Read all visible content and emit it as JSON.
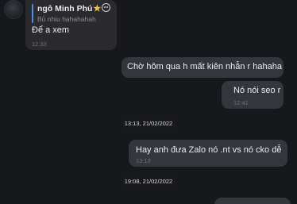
{
  "messages": [
    {
      "sender": "ngô Minh Phú",
      "quote": "Bủ nhiu hahahahah",
      "text": "Để a xem",
      "time": "12:33"
    },
    {
      "text": "Chờ hôm qua h mất kiên nhẫn r hahaha"
    },
    {
      "text": "Nó nói seo r",
      "time": "12:41"
    },
    {
      "text": "Hay anh đưa Zalo nó .nt vs nó cko dễ",
      "time": "13:13"
    }
  ],
  "date_separators": [
    "13:13, 21/02/2022",
    "19:08, 21/02/2022"
  ],
  "icons": {
    "badge_star": "star-icon",
    "badge_emoji": "smiley-face-icon"
  },
  "colors": {
    "background": "#17181b",
    "incoming_bubble": "#2b2b2f",
    "outgoing_bubble": "#33363d",
    "reply_accent": "#4a8fe7",
    "star": "#f2c53d"
  }
}
